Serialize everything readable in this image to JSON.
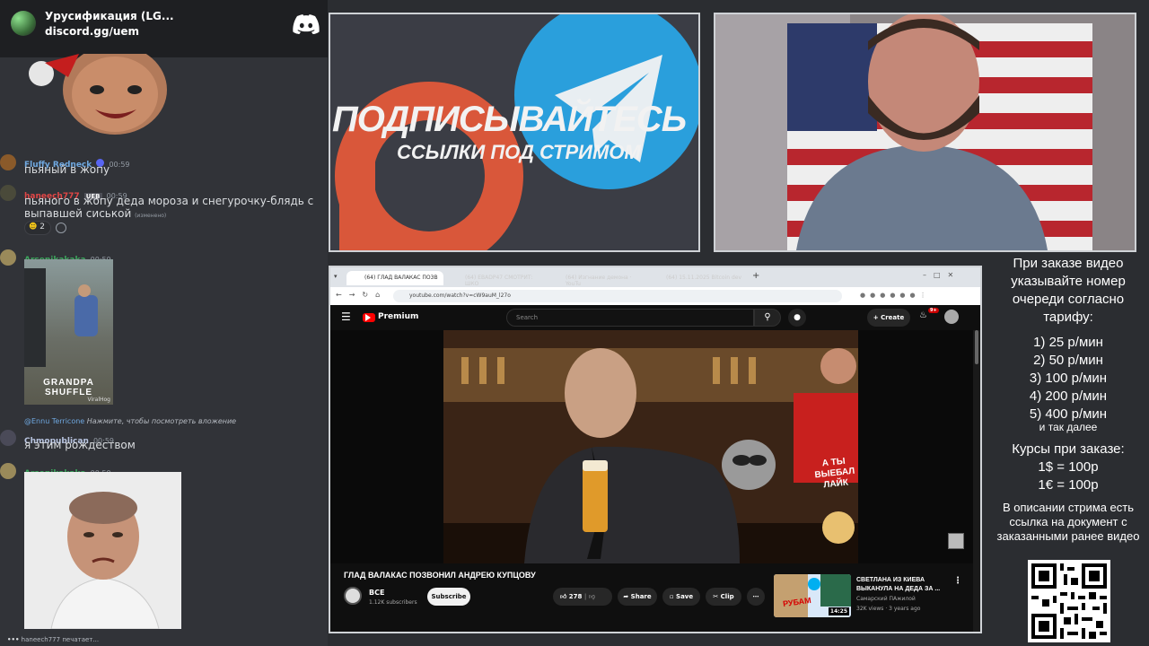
{
  "discord": {
    "server_name": "Урусификация (LG...",
    "invite": "discord.gg/uem",
    "messages": [
      {
        "author": "Fluffy Redneck",
        "time": "00:59",
        "text": "пьяный в жопу"
      },
      {
        "author": "haneech777",
        "badge": "UEB",
        "time": "00:59",
        "text": "пьяного в жопу деда мороза и снегурочку-блядь с выпавшей сиськой",
        "edited": "(изменено)",
        "reaction_count": "2"
      },
      {
        "author": "Arsenikakaka",
        "time": "00:59",
        "image_caption": "GRANDPA SHUFFLE",
        "watermark": "ViralHog"
      },
      {
        "reply_to": "@Ennu Terricone",
        "reply_text": "Нажмите, чтобы посмотреть вложение",
        "author": "Chmopublican",
        "time": "00:59",
        "text": "я этим рождеством"
      },
      {
        "author": "Arsenikakaka",
        "time": "00:59"
      }
    ],
    "typing": "haneech777 печатает..."
  },
  "ad": {
    "line1": "ПОДПИСЫВАЙТЕСЬ",
    "line2": "ССЫЛКИ ПОД СТРИМОМ"
  },
  "browser": {
    "tabs": [
      "(64) ГЛАД ВАЛАКАС ПОЗВ",
      "(64) EBADP47 СМОТРИТ: ШКО",
      "(64) Изгнание демона · YouTu",
      "(64) 15.11.2025 Bitcoin dev"
    ],
    "url": "youtube.com/watch?v=cW9auM_l27o",
    "yt_brand": "Premium",
    "search_placeholder": "Search",
    "create_label": "Create",
    "notif_count": "9+",
    "video_title": "ГЛАД ВАЛАКАС ПОЗВОНИЛ АНДРЕЮ КУПЦОВУ",
    "channel_name": "ВСЕ",
    "subscribers": "1.12K subscribers",
    "subscribe_label": "Subscribe",
    "likes": "278",
    "share_label": "Share",
    "save_label": "Save",
    "clip_label": "Clip",
    "thumbnail_overlay": "А ТЫ ВЫЕБАЛ ЛАЙК",
    "rec_title": "СВЕТЛАНА ИЗ КИЕВА ВЫКАНУЛА НА ДЕДА ЗА ...",
    "rec_channel": "Самарский ПАжилой",
    "rec_meta": "32K views · 3 years ago",
    "rec_duration": "14:25",
    "rec_thumb_text": "РУБАМ"
  },
  "info": {
    "intro": "При заказе видео указывайте номер очереди согласно тарифу:",
    "tariffs": [
      "1) 25 р/мин",
      "2) 50 р/мин",
      "3) 100 р/мин",
      "4) 200 р/мин",
      "5) 400 р/мин"
    ],
    "tariffs_more": "и так далее",
    "rates_title": "Курсы при заказе:",
    "rates": [
      "1$ = 100р",
      "1€ = 100р"
    ],
    "note": "В описании стрима есть ссылка на документ с заказанными ранее видео"
  },
  "colors": {
    "discord_bg": "#313338",
    "yt_red": "#ff0000",
    "telegram": "#2aa3dd",
    "patreon": "#e8573c"
  }
}
